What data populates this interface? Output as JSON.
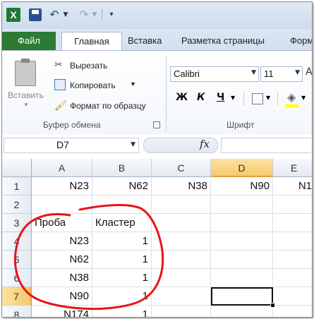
{
  "qat": {
    "app_icon": "X",
    "icons": [
      "excel-icon",
      "save-icon",
      "undo-icon",
      "redo-icon",
      "customize-arrow-icon"
    ]
  },
  "tabs": {
    "file": "Файл",
    "home": "Главная",
    "insert": "Вставка",
    "layout": "Разметка страницы",
    "formulas": "Форм"
  },
  "ribbon": {
    "clipboard": {
      "paste": "Вставить",
      "cut": "Вырезать",
      "copy": "Копировать",
      "format_painter": "Формат по образцу",
      "group_label": "Буфер обмена"
    },
    "font": {
      "name": "Calibri",
      "size": "11",
      "bold": "Ж",
      "italic": "К",
      "underline": "Ч",
      "group_label": "Шрифт"
    }
  },
  "formula_bar": {
    "name_box": "D7",
    "fx": "fx",
    "formula": ""
  },
  "grid": {
    "columns": [
      "A",
      "B",
      "C",
      "D",
      "E"
    ],
    "active_column": "D",
    "rows": [
      "1",
      "2",
      "3",
      "4",
      "5",
      "6",
      "7",
      "8"
    ],
    "active_row": "7",
    "cells": {
      "A1": "N23",
      "B1": "N62",
      "C1": "N38",
      "D1": "N90",
      "E1": "N1",
      "A3": "Проба",
      "B3": "Кластер",
      "A4": "N23",
      "B4": "1",
      "A5": "N62",
      "B5": "1",
      "A6": "N38",
      "B6": "1",
      "A7": "N90",
      "B7": "1",
      "A8": "N174",
      "B8": "1"
    },
    "selected_cell": "D7"
  },
  "colors": {
    "file_tab": "#2c7a33",
    "active_header": "#f7c86a",
    "annotation": "#e8141a"
  }
}
